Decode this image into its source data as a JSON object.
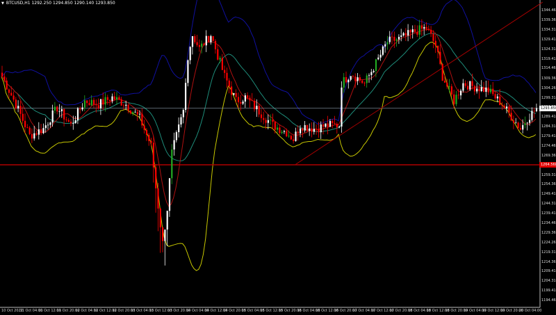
{
  "header": {
    "symbol": "BTCUSD,H1",
    "ohlc": "1292.250 1294.850 1290.140 1293.850"
  },
  "colors": {
    "background": "#000000",
    "bull": "#ffffff",
    "bull_alt": "#22aa22",
    "bear": "#ff0000",
    "upper_band": "#1010a0",
    "lower_band": "#c8c800",
    "middle_band": "#1e8c7a",
    "fast_ma": "#b01010",
    "support_line": "#b00000",
    "trendline": "#a00000",
    "grid_axis": "#c0c0c0"
  },
  "chart_data": {
    "type": "candlestick",
    "ylim": [
      1191.5,
      1349.9
    ],
    "close_path": [
      [
        0,
        1310.3
      ],
      [
        6,
        1295.9
      ],
      [
        12,
        1279.7
      ],
      [
        18,
        1283.3
      ],
      [
        24,
        1294.1
      ],
      [
        30,
        1285.1
      ],
      [
        36,
        1297.7
      ],
      [
        42,
        1295.9
      ],
      [
        48,
        1299.5
      ],
      [
        54,
        1295.9
      ],
      [
        60,
        1288.7
      ],
      [
        65,
        1274.3
      ],
      [
        67,
        1252.7
      ],
      [
        70,
        1223.9
      ],
      [
        72,
        1241.9
      ],
      [
        74,
        1270.7
      ],
      [
        79,
        1292.3
      ],
      [
        81,
        1321.1
      ],
      [
        83,
        1331.9
      ],
      [
        86,
        1324.7
      ],
      [
        91,
        1331.9
      ],
      [
        93,
        1324.7
      ],
      [
        95,
        1317.5
      ],
      [
        97,
        1310.3
      ],
      [
        102,
        1297.7
      ],
      [
        106,
        1299.5
      ],
      [
        112,
        1292.3
      ],
      [
        118,
        1285.1
      ],
      [
        124,
        1281.5
      ],
      [
        127,
        1277.9
      ],
      [
        130,
        1285.1
      ],
      [
        136,
        1283.3
      ],
      [
        142,
        1285.1
      ],
      [
        147,
        1285.1
      ],
      [
        148,
        1306.7
      ],
      [
        152,
        1312.1
      ],
      [
        158,
        1306.7
      ],
      [
        164,
        1319.3
      ],
      [
        168,
        1328.3
      ],
      [
        174,
        1330.1
      ],
      [
        180,
        1333.7
      ],
      [
        185,
        1335.5
      ],
      [
        189,
        1326.5
      ],
      [
        192,
        1310.3
      ],
      [
        197,
        1297.7
      ],
      [
        201,
        1306.7
      ],
      [
        206,
        1304.9
      ],
      [
        212,
        1303.1
      ],
      [
        218,
        1295.9
      ],
      [
        226,
        1283.3
      ],
      [
        229,
        1288.7
      ],
      [
        233,
        1293.85
      ]
    ],
    "price_ticks": [
      "1344.460",
      "1339.360",
      "1334.310",
      "1329.410",
      "1324.310",
      "1319.410",
      "1314.460",
      "1309.360",
      "1304.260",
      "1299.310",
      "1294.360",
      "1289.410",
      "1284.310",
      "1279.410",
      "1274.460",
      "1269.360",
      "1259.310",
      "1254.360",
      "1249.410",
      "1244.310",
      "1239.410",
      "1234.460",
      "1229.360",
      "1224.260",
      "1219.310",
      "1214.360",
      "1209.410",
      "1204.310",
      "1199.410",
      "1194.460"
    ],
    "time_ticks": [
      "10 Oct 2022",
      "11 Oct 04:00",
      "11 Oct 12:00",
      "11 Oct 20:00",
      "12 Oct 04:00",
      "12 Oct 12:00",
      "12 Oct 20:00",
      "13 Oct 04:00",
      "13 Oct 12:00",
      "13 Oct 20:00",
      "14 Oct 04:00",
      "14 Oct 12:00",
      "14 Oct 20:00",
      "15 Oct 04:00",
      "15 Oct 12:00",
      "15 Oct 20:00",
      "16 Oct 04:00",
      "16 Oct 12:00",
      "16 Oct 20:00",
      "17 Oct 04:00",
      "17 Oct 12:00",
      "17 Oct 20:00",
      "18 Oct 04:00",
      "18 Oct 12:00",
      "18 Oct 20:00",
      "19 Oct 04:00",
      "19 Oct 12:00",
      "19 Oct 20:00",
      "20 Oct 04:00"
    ],
    "support_level": {
      "price": 1264.56,
      "label": "1264.560"
    },
    "current_price": {
      "price": 1293.85,
      "label": "1293.850"
    },
    "trendline": {
      "start": [
        128,
        1264.56
      ],
      "end": [
        236,
        1348.8
      ]
    },
    "indicators": [
      "bollinger_bands",
      "moving_average"
    ]
  }
}
